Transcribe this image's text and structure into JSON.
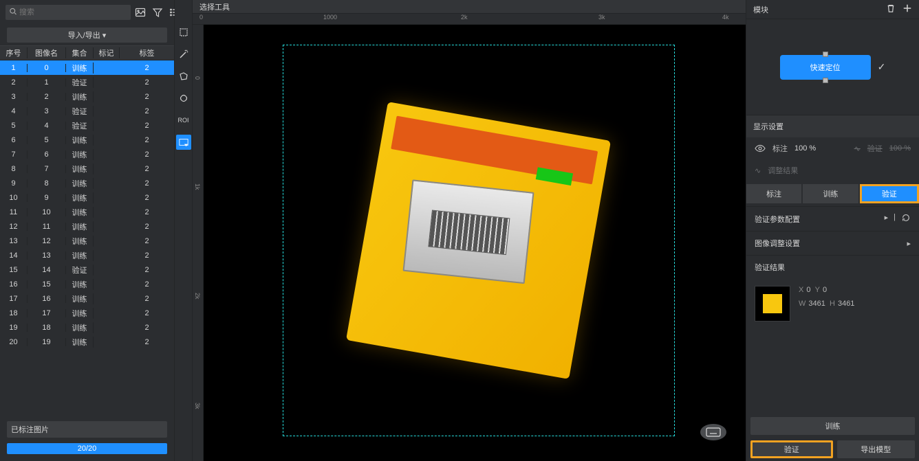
{
  "search": {
    "placeholder": "搜索"
  },
  "import_export_label": "导入/导出 ▾",
  "table": {
    "headers": {
      "idx": "序号",
      "name": "图像名",
      "set": "集合",
      "mark": "标记",
      "tag": "标签"
    },
    "rows": [
      {
        "idx": "1",
        "name": "0",
        "set": "训练",
        "tag": "2",
        "selected": true
      },
      {
        "idx": "2",
        "name": "1",
        "set": "验证",
        "tag": "2"
      },
      {
        "idx": "3",
        "name": "2",
        "set": "训练",
        "tag": "2"
      },
      {
        "idx": "4",
        "name": "3",
        "set": "验证",
        "tag": "2"
      },
      {
        "idx": "5",
        "name": "4",
        "set": "验证",
        "tag": "2"
      },
      {
        "idx": "6",
        "name": "5",
        "set": "训练",
        "tag": "2"
      },
      {
        "idx": "7",
        "name": "6",
        "set": "训练",
        "tag": "2"
      },
      {
        "idx": "8",
        "name": "7",
        "set": "训练",
        "tag": "2"
      },
      {
        "idx": "9",
        "name": "8",
        "set": "训练",
        "tag": "2"
      },
      {
        "idx": "10",
        "name": "9",
        "set": "训练",
        "tag": "2"
      },
      {
        "idx": "11",
        "name": "10",
        "set": "训练",
        "tag": "2"
      },
      {
        "idx": "12",
        "name": "11",
        "set": "训练",
        "tag": "2"
      },
      {
        "idx": "13",
        "name": "12",
        "set": "训练",
        "tag": "2"
      },
      {
        "idx": "14",
        "name": "13",
        "set": "训练",
        "tag": "2"
      },
      {
        "idx": "15",
        "name": "14",
        "set": "验证",
        "tag": "2"
      },
      {
        "idx": "16",
        "name": "15",
        "set": "训练",
        "tag": "2"
      },
      {
        "idx": "17",
        "name": "16",
        "set": "训练",
        "tag": "2"
      },
      {
        "idx": "18",
        "name": "17",
        "set": "训练",
        "tag": "2"
      },
      {
        "idx": "19",
        "name": "18",
        "set": "训练",
        "tag": "2"
      },
      {
        "idx": "20",
        "name": "19",
        "set": "训练",
        "tag": "2"
      }
    ]
  },
  "footer": {
    "labeled_images": "已标注图片",
    "progress_text": "20/20"
  },
  "center": {
    "header": "选择工具",
    "ruler_h": [
      "0",
      "1000",
      "2k",
      "3k",
      "4k"
    ],
    "ruler_v": [
      "0",
      "1k",
      "2k",
      "3k"
    ]
  },
  "tools": {
    "roi_label": "ROI"
  },
  "right": {
    "module_title": "模块",
    "quick_locate": "快速定位",
    "display_settings": "显示设置",
    "annotation": "标注",
    "verify": "验证",
    "opacity": "100 %",
    "adjust_result": "调整结果",
    "tabs": {
      "ann": "标注",
      "train": "训练",
      "verify": "验证"
    },
    "verify_params": "验证参数配置",
    "image_adjust": "图像调整设置",
    "verify_result": "验证结果",
    "result": {
      "x_label": "X",
      "x": "0",
      "y_label": "Y",
      "y": "0",
      "w_label": "W",
      "w": "3461",
      "h_label": "H",
      "h": "3461"
    },
    "train_btn": "训练",
    "verify_btn": "验证",
    "export_btn": "导出模型"
  }
}
